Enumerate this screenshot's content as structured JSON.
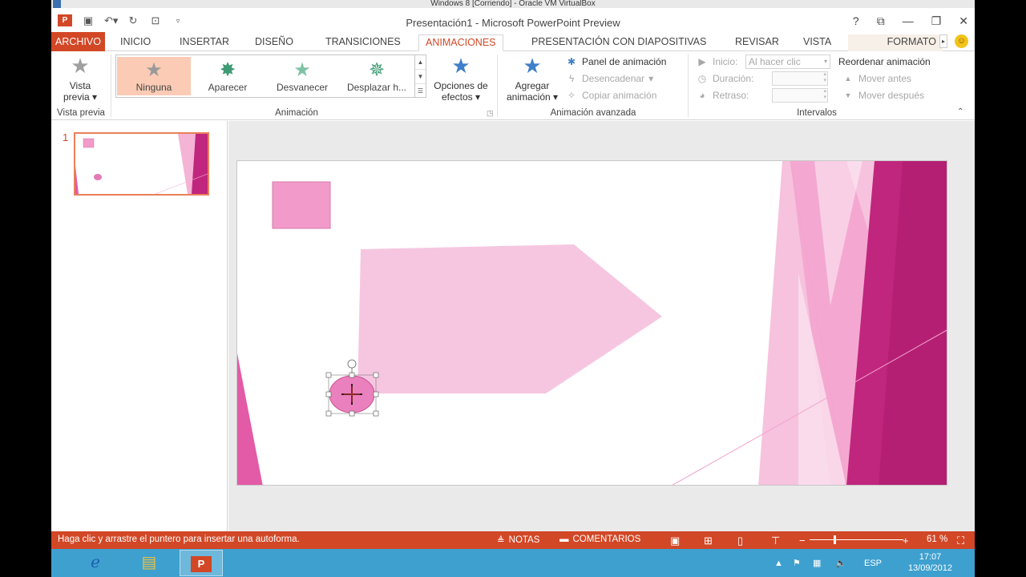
{
  "vbox": {
    "title": "Windows 8 [Corriendo] - Oracle VM VirtualBox"
  },
  "titlebar": {
    "doc_title": "Presentación1 - Microsoft PowerPoint Preview",
    "help": "?"
  },
  "tabs": [
    {
      "label": "ARCHIVO"
    },
    {
      "label": "INICIO"
    },
    {
      "label": "INSERTAR"
    },
    {
      "label": "DISEÑO"
    },
    {
      "label": "TRANSICIONES"
    },
    {
      "label": "ANIMACIONES"
    },
    {
      "label": "PRESENTACIÓN CON DIAPOSITIVAS"
    },
    {
      "label": "REVISAR"
    },
    {
      "label": "VISTA"
    },
    {
      "label": "FORMATO"
    }
  ],
  "ribbon": {
    "preview": {
      "label": "Vista previa",
      "group": "Vista previa"
    },
    "animation_group": "Animación",
    "gallery": [
      {
        "label": "Ninguna",
        "color": "#9a9a9a"
      },
      {
        "label": "Aparecer",
        "color": "#3e9b75"
      },
      {
        "label": "Desvanecer",
        "color": "#7fc3a4"
      },
      {
        "label": "Desplazar h...",
        "color": "#3e9b75"
      }
    ],
    "effect_options": {
      "line1": "Opciones de",
      "line2": "efectos"
    },
    "add_animation": {
      "line1": "Agregar",
      "line2": "animación"
    },
    "advanced": {
      "panel": "Panel de animación",
      "trigger": "Desencadenar",
      "copy": "Copiar animación",
      "group": "Animación avanzada"
    },
    "timing": {
      "start_label": "Inicio:",
      "start_value": "Al hacer clic",
      "duration_label": "Duración:",
      "delay_label": "Retraso:",
      "reorder": "Reordenar animación",
      "move_earlier": "Mover antes",
      "move_later": "Mover después",
      "group": "Intervalos"
    }
  },
  "thumbnails": {
    "slide_number": "1"
  },
  "status": {
    "message": "Haga clic y arrastre el puntero para insertar una autoforma.",
    "notes": "NOTAS",
    "comments": "COMENTARIOS",
    "zoom": "61 %"
  },
  "taskbar": {
    "lang": "ESP",
    "time": "17:07",
    "date": "13/09/2012"
  },
  "colors": {
    "accent": "#d24726",
    "taskbar": "#3ea0cf",
    "pink": "#f29ac9",
    "magenta": "#c0267d"
  }
}
